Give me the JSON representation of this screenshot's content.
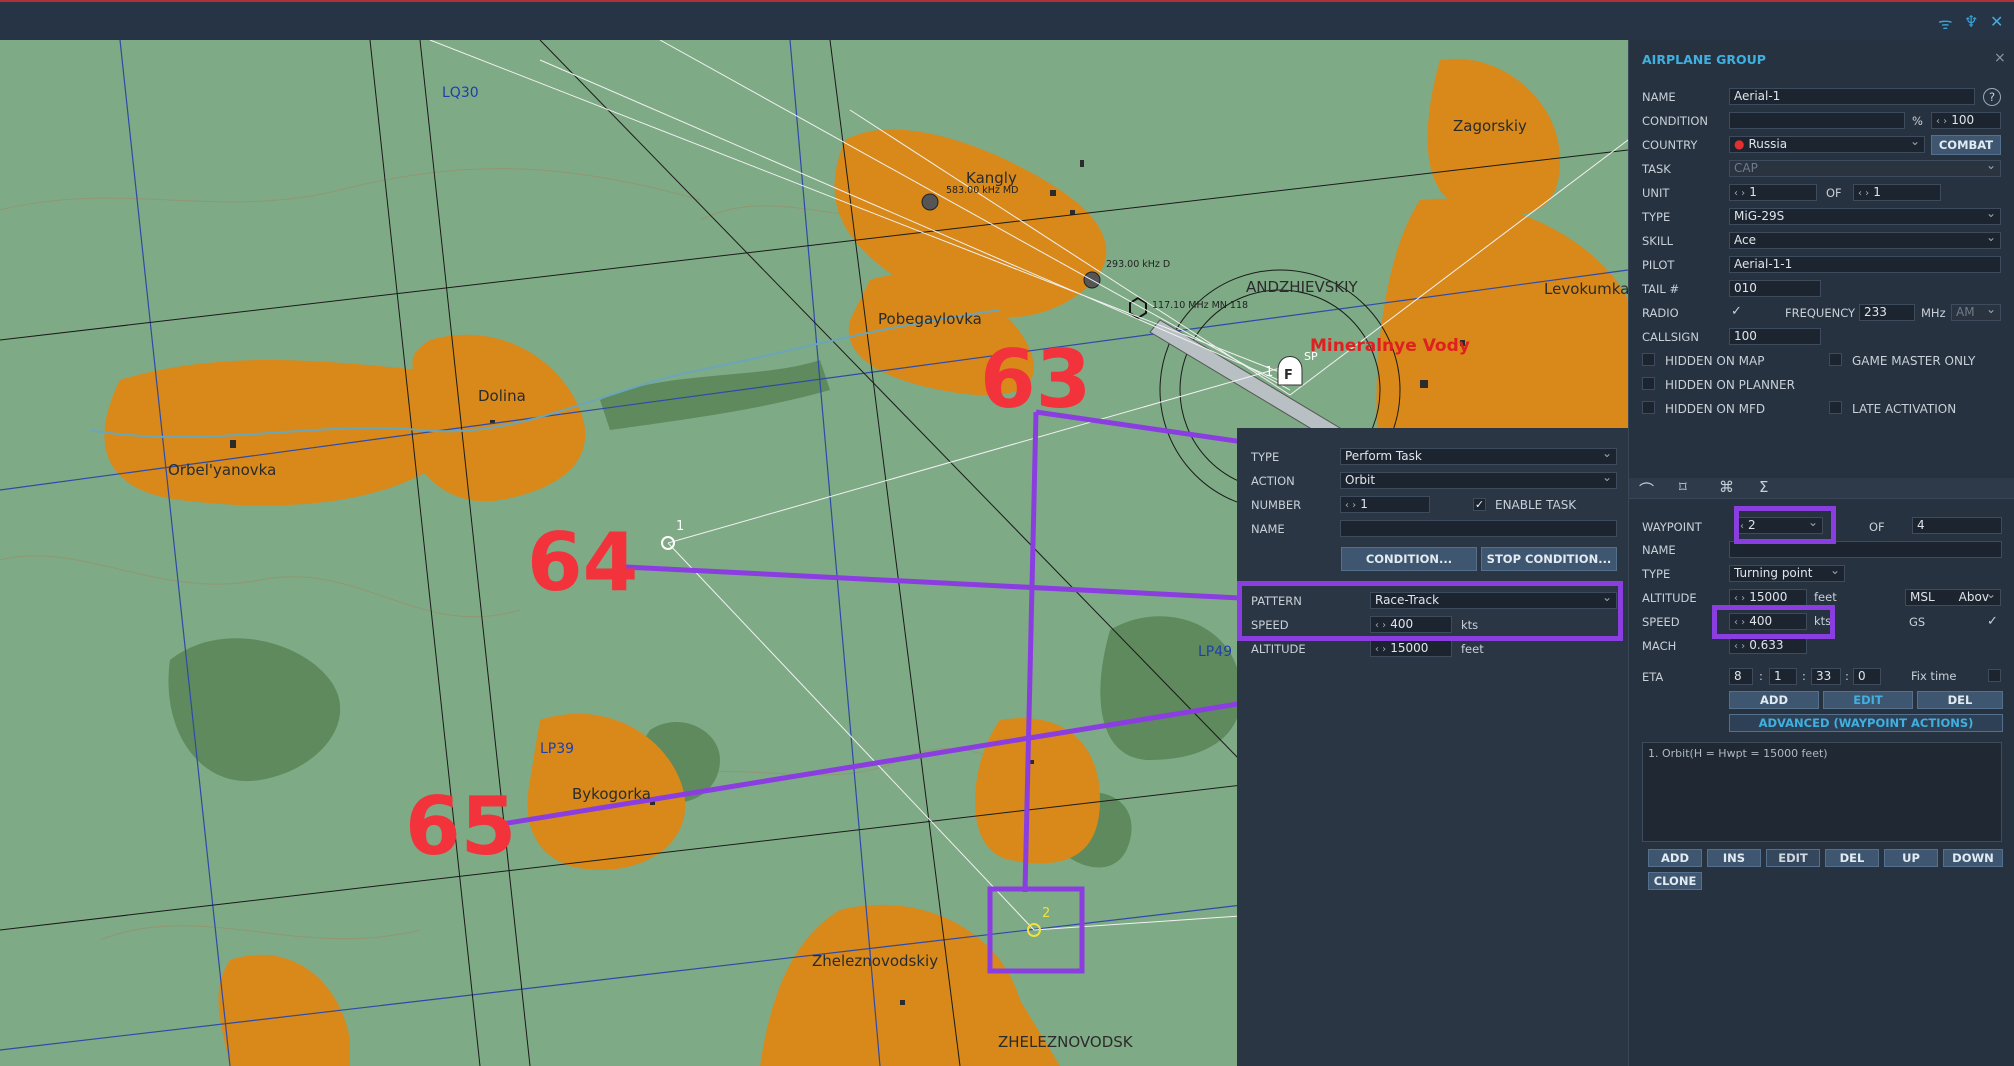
{
  "map": {
    "grid_labels": [
      "LQ30",
      "LP49",
      "LP39"
    ],
    "towns": [
      "Kangly",
      "Zagorskiy",
      "Pobegaylovka",
      "ANDZHIEVSKIY",
      "Levokumka",
      "Dolina",
      "Orbel'yanovka",
      "Bykogorka",
      "Zheleznovodskiy",
      "ZHELEZNOVODSK"
    ],
    "beacons": [
      "583.00 kHz MD",
      "293.00 kHz D",
      "117.10 MHz MN 118"
    ],
    "airfield": "Mineralnye Vody",
    "airfield_marker": "F",
    "sp": "SP",
    "wp_labels": [
      "1",
      "1",
      "2"
    ]
  },
  "annotations": [
    "63",
    "64",
    "65"
  ],
  "task_panel": {
    "type_label": "TYPE",
    "type_value": "Perform Task",
    "action_label": "ACTION",
    "action_value": "Orbit",
    "number_label": "NUMBER",
    "number_value": "1",
    "enable_task": "ENABLE TASK",
    "name_label": "NAME",
    "condition_btn": "CONDITION...",
    "stop_condition_btn": "STOP CONDITION...",
    "pattern_label": "PATTERN",
    "pattern_value": "Race-Track",
    "speed_label": "SPEED",
    "speed_value": "400",
    "speed_unit": "kts",
    "altitude_label": "ALTITUDE",
    "altitude_value": "15000",
    "altitude_unit": "feet"
  },
  "group_panel": {
    "title": "AIRPLANE GROUP",
    "close": "×",
    "name_label": "NAME",
    "name_value": "Aerial-1",
    "help": "?",
    "condition_label": "CONDITION",
    "condition_pct": "%",
    "condition_value": "100",
    "country_label": "COUNTRY",
    "country_value": "Russia",
    "combat_btn": "COMBAT",
    "task_label": "TASK",
    "task_value": "CAP",
    "unit_label": "UNIT",
    "unit_value": "1",
    "unit_of": "OF",
    "unit_of_value": "1",
    "type_label": "TYPE",
    "type_value": "MiG-29S",
    "skill_label": "SKILL",
    "skill_value": "Ace",
    "pilot_label": "PILOT",
    "pilot_value": "Aerial-1-1",
    "tail_label": "TAIL #",
    "tail_value": "010",
    "radio_label": "RADIO",
    "radio_check": "✓",
    "frequency_label": "FREQUENCY",
    "frequency_value": "233",
    "frequency_unit": "MHz",
    "modulation": "AM",
    "callsign_label": "CALLSIGN",
    "callsign_value": "100",
    "hidden_on_map": "HIDDEN ON MAP",
    "game_master_only": "GAME MASTER ONLY",
    "hidden_on_planner": "HIDDEN ON PLANNER",
    "hidden_on_mfd": "HIDDEN ON MFD",
    "late_activation": "LATE ACTIVATION"
  },
  "waypoint_panel": {
    "tabs": [
      "route-icon",
      "triggered-actions-icon",
      "payload-icon",
      "summary-icon"
    ],
    "waypoint_label": "WAYPOINT",
    "waypoint_value": "2",
    "waypoint_of": "OF",
    "waypoint_total": "4",
    "name_label": "NAME",
    "type_label": "TYPE",
    "type_value": "Turning point",
    "altitude_label": "ALTITUDE",
    "altitude_value": "15000",
    "altitude_unit": "feet",
    "alt_ref": "MSL",
    "alt_mode": "Abov",
    "speed_label": "SPEED",
    "speed_value": "400",
    "speed_unit": "kts",
    "gs_label": "GS",
    "gs_check": "✓",
    "mach_label": "MACH",
    "mach_value": "0.633",
    "eta_label": "ETA",
    "eta_d": "8",
    "eta_h": "1",
    "eta_m": "33",
    "eta_s": "0",
    "sep": ":",
    "fix_time": "Fix time",
    "add_btn": "ADD",
    "edit_btn": "EDIT",
    "del_btn": "DEL",
    "advanced_btn": "ADVANCED (WAYPOINT ACTIONS)",
    "actions": [
      "1. Orbit(H = Hwpt = 15000 feet)"
    ],
    "list_buttons": [
      "ADD",
      "INS",
      "EDIT",
      "DEL",
      "UP",
      "DOWN",
      "CLONE"
    ]
  },
  "colors": {
    "map_green": "#7faa86",
    "town_orange": "#d8891a",
    "highlight": "#8a3ee0",
    "annotation": "#f2333c"
  }
}
